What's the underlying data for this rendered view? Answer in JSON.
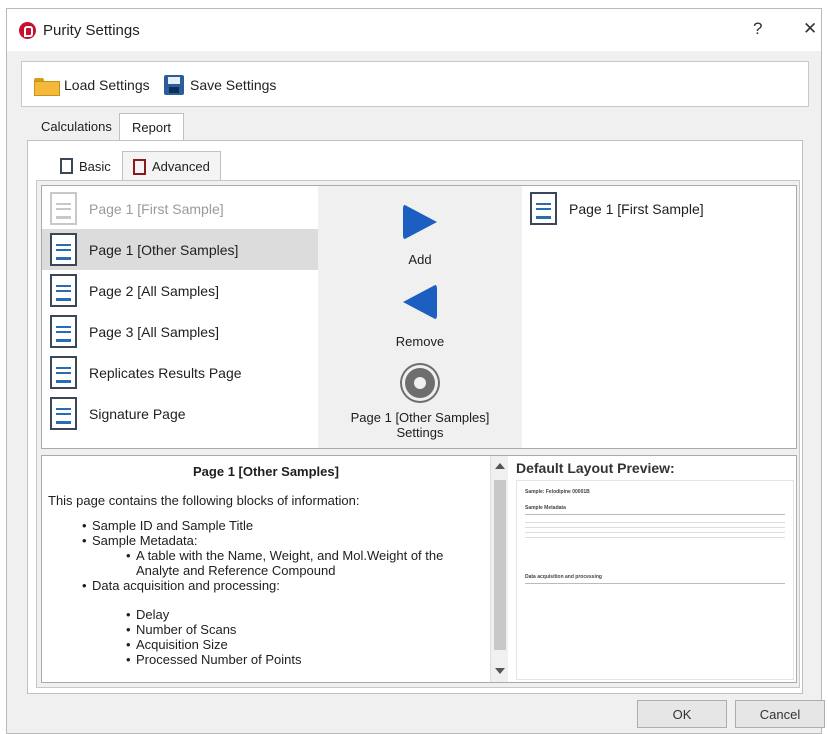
{
  "window": {
    "title": "Purity Settings",
    "help_label": "?",
    "close_label": "✕"
  },
  "toolbar": {
    "load_label": "Load Settings",
    "save_label": "Save Settings"
  },
  "tabs": [
    {
      "label": "Calculations",
      "active": false
    },
    {
      "label": "Report",
      "active": true
    }
  ],
  "subtabs": [
    {
      "label": "Basic",
      "active": false
    },
    {
      "label": "Advanced",
      "active": true
    }
  ],
  "available_pages": [
    {
      "label": "Page 1 [First Sample]",
      "state": "disabled"
    },
    {
      "label": "Page 1 [Other Samples]",
      "state": "selected"
    },
    {
      "label": "Page 2 [All Samples]",
      "state": "normal"
    },
    {
      "label": "Page 3 [All Samples]",
      "state": "normal"
    },
    {
      "label": "Replicates Results Page",
      "state": "normal"
    },
    {
      "label": "Signature Page",
      "state": "normal"
    }
  ],
  "actions": {
    "add_label": "Add",
    "remove_label": "Remove",
    "settings_line1": "Page 1 [Other Samples]",
    "settings_line2": "Settings"
  },
  "selected_pages": [
    {
      "label": "Page 1 [First Sample]"
    }
  ],
  "description": {
    "heading": "Page 1 [Other Samples]",
    "intro": "This page contains the following blocks of information:",
    "item1": "Sample ID and Sample Title",
    "item2": "Sample Metadata:",
    "item2a_line1": "A table with the Name, Weight, and Mol.Weight of the",
    "item2a_line2": "Analyte and Reference Compound",
    "item3": "Data acquisition and processing:",
    "sub1": "Delay",
    "sub2": "Number of Scans",
    "sub3": "Acquisition Size",
    "sub4": "Processed Number of Points"
  },
  "preview": {
    "title": "Default Layout Preview:",
    "sample_line": "Sample: Felodipine 00001B",
    "section1": "Sample Metadata",
    "section2": "Data acquisition and processing"
  },
  "footer": {
    "ok_label": "OK",
    "cancel_label": "Cancel"
  },
  "colors": {
    "accent_blue": "#1c5fc0",
    "brand_red": "#c8102e",
    "selection_gray": "#dcdcdc"
  }
}
